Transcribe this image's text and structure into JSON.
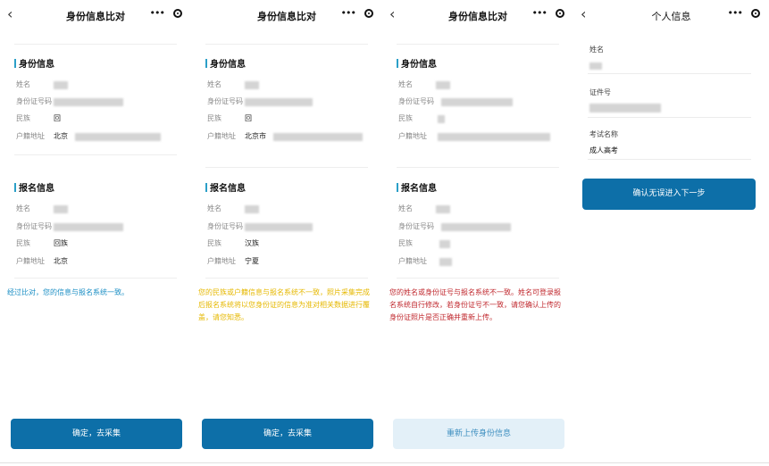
{
  "nav": {
    "back": "‹",
    "menu": "•••",
    "compare_title": "身份信息比对",
    "personal_title": "个人信息"
  },
  "sections": {
    "identity": "身份信息",
    "registration": "报名信息"
  },
  "labels": {
    "name": "姓名",
    "id_number": "身份证号码",
    "ethnicity": "民族",
    "household": "户籍地址"
  },
  "panel1": {
    "id_ethnicity": "回",
    "id_household": "北京",
    "reg_ethnicity": "回族",
    "reg_household": "北京",
    "message": "经过比对，您的信息与报名系统一致。",
    "button": "确定，去采集"
  },
  "panel2": {
    "id_ethnicity": "回",
    "id_household": "北京市",
    "reg_ethnicity": "汉族",
    "reg_household": "宁夏",
    "message": "您的民族或户籍信息与报名系统不一致，照片采集完成后报名系统将以您身份证的信息为准对相关数据进行覆盖，请您知悉。",
    "button": "确定，去采集"
  },
  "panel3": {
    "message": "您的姓名或身份证号与报名系统不一致。姓名可登录报名系统自行修改，若身份证号不一致，请您确认上传的身份证照片是否正确并重新上传。",
    "button": "重新上传身份信息"
  },
  "panel4": {
    "name_label": "姓名",
    "id_label": "证件号",
    "exam_label": "考试名称",
    "exam_value": "成人高考",
    "button": "确认无误进入下一步"
  },
  "colors": {
    "accent": "#0d6fa8",
    "section_bar": "#2b9fc8",
    "msg_ok": "#1a8ec4",
    "msg_warn": "#e6b800",
    "msg_error": "#c0282e"
  }
}
